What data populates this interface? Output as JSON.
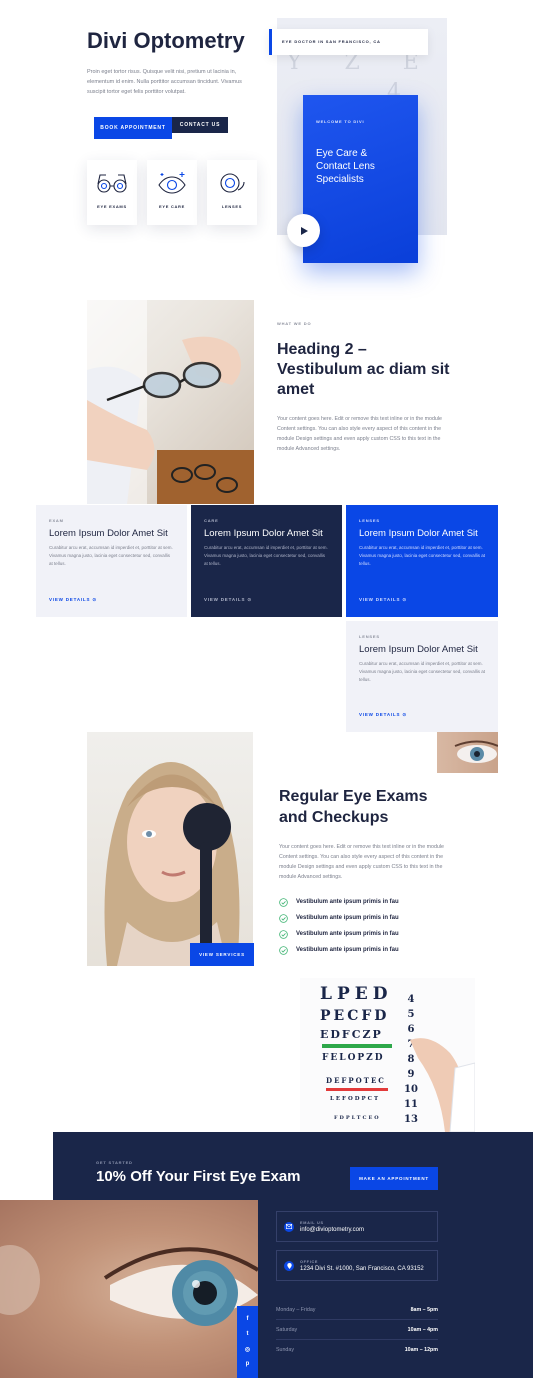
{
  "hero": {
    "title": "Divi Optometry",
    "description": "Proin eget tortor risus. Quisque velit nisi, pretium ut lacinia in, elementum id enim. Nulla porttitor accumsan tincidunt. Vivamus suscipit tortor eget felis porttitor volutpat.",
    "book_button": "BOOK APPOINTMENT",
    "contact_button": "CONTACT US",
    "services": [
      {
        "label": "EYE EXAMS",
        "icon": "eyeglasses-icon"
      },
      {
        "label": "EYE CARE",
        "icon": "eye-sparkle-icon"
      },
      {
        "label": "LENSES",
        "icon": "contact-lens-icon"
      }
    ],
    "location_label": "EYE DOCTOR IN SAN FRANCISCO, CA",
    "card_kicker": "WELCOME TO DIVI",
    "card_title": "Eye Care & Contact Lens Specialists"
  },
  "about": {
    "kicker": "WHAT WE DO",
    "heading": "Heading 2 – Vestibulum ac diam sit amet",
    "body": "Your content goes here. Edit or remove this text inline or in the module Content settings. You can also style every aspect of this content in the module Design settings and even apply custom CSS to this text in the module Advanced settings."
  },
  "cards": [
    {
      "kicker": "EXAM",
      "title": "Lorem Ipsum Dolor Amet Sit",
      "body": "Curabitur arcu erat, accumsan id imperdiet et, porttitor at sem. Vivamus magna justo, lacinia eget consectetur sed, convallis at tellus.",
      "link": "VIEW DETAILS"
    },
    {
      "kicker": "CARE",
      "title": "Lorem Ipsum Dolor Amet Sit",
      "body": "Curabitur arcu erat, accumsan id imperdiet et, porttitor at sem. Vivamus magna justo, lacinia eget consectetur sed, convallis at tellus.",
      "link": "VIEW DETAILS"
    },
    {
      "kicker": "LENSES",
      "title": "Lorem Ipsum Dolor Amet Sit",
      "body": "Curabitur arcu erat, accumsan id imperdiet et, porttitor at sem. Vivamus magna justo, lacinia eget consectetur sed, convallis at tellus.",
      "link": "VIEW DETAILS"
    },
    {
      "kicker": "LENSES",
      "title": "Lorem Ipsum Dolor Amet Sit",
      "body": "Curabitur arcu erat, accumsan id imperdiet et, porttitor at sem. Vivamus magna justo, lacinia eget consectetur sed, convallis at tellus.",
      "link": "VIEW DETAILS"
    }
  ],
  "exams": {
    "heading": "Regular Eye Exams and Checkups",
    "body": "Your content goes here. Edit or remove this text inline or in the module Content settings. You can also style every aspect of this content in the module Design settings and even apply custom CSS to this text in the module Advanced settings.",
    "checklist": [
      "Vestibulum ante ipsum primis in fau",
      "Vestibulum ante ipsum primis in fau",
      "Vestibulum ante ipsum primis in fau",
      "Vestibulum ante ipsum primis in fau"
    ],
    "services_button": "VIEW SERVICES",
    "eye_chart_rows": [
      "LPED",
      "PECFD",
      "EDFCZP",
      "FELOPZD",
      "DEFPOTEC",
      "LEFODPCT",
      "FDPLTCEO"
    ],
    "eye_chart_numbers": [
      "4",
      "5",
      "6",
      "7",
      "8",
      "9",
      "10",
      "11",
      "13"
    ]
  },
  "footer": {
    "kicker": "GET STARTED",
    "heading": "10% Off Your First Eye Exam",
    "appointment_button": "MAKE AN APPOINTMENT",
    "email_label": "EMAIL US",
    "email": "info@divioptometry.com",
    "office_label": "OFFICE",
    "address": "1234 Divi St. #1000, San Francisco, CA 93152",
    "hours": [
      {
        "day": "Monday – Friday",
        "time": "8am – 5pm"
      },
      {
        "day": "Saturday",
        "time": "10am – 4pm"
      },
      {
        "day": "Sunday",
        "time": "10am – 12pm"
      }
    ],
    "social": [
      "facebook-icon",
      "twitter-icon",
      "instagram-icon",
      "pinterest-icon"
    ]
  },
  "colors": {
    "accent": "#0a47e6",
    "navy": "#1a2649",
    "light": "#f1f2f8",
    "check": "#3cb371"
  }
}
